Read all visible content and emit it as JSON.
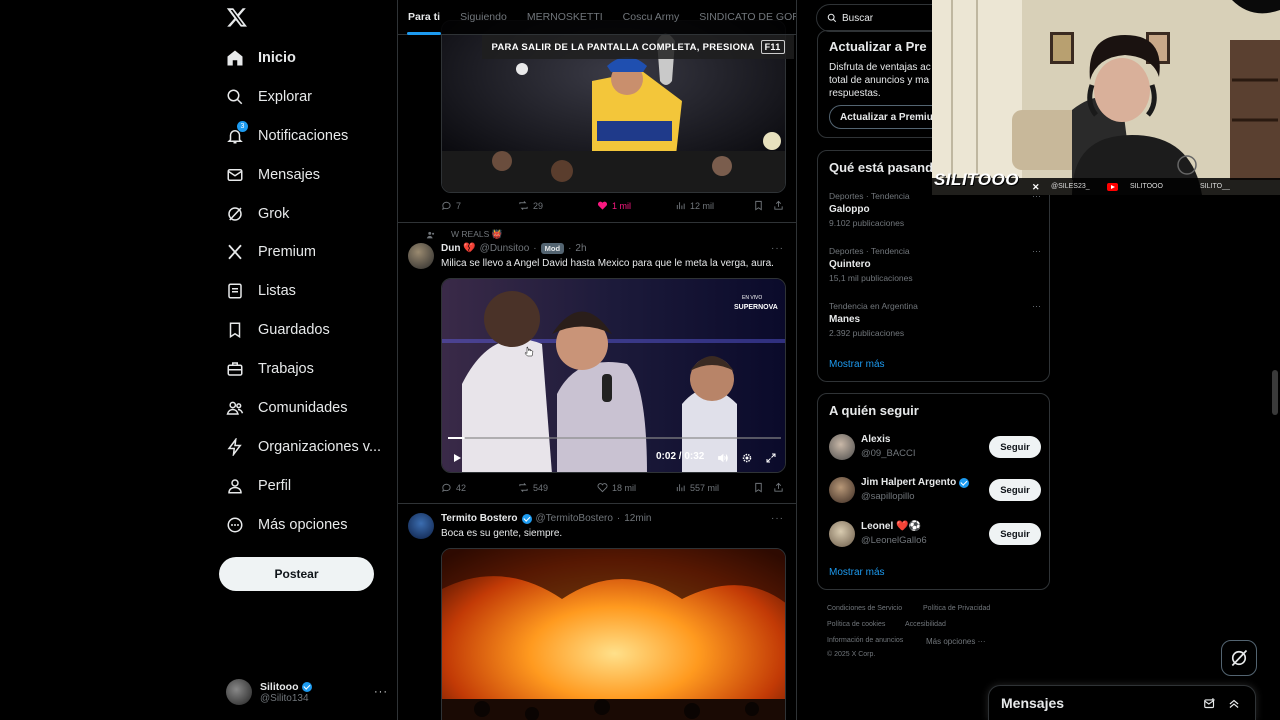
{
  "nav": {
    "items": [
      {
        "label": "Inicio",
        "icon": "home-icon"
      },
      {
        "label": "Explorar",
        "icon": "search-icon"
      },
      {
        "label": "Notificaciones",
        "icon": "bell-icon",
        "badge": "3"
      },
      {
        "label": "Mensajes",
        "icon": "mail-icon"
      },
      {
        "label": "Grok",
        "icon": "grok-icon"
      },
      {
        "label": "Premium",
        "icon": "x-logo-icon"
      },
      {
        "label": "Listas",
        "icon": "list-icon"
      },
      {
        "label": "Guardados",
        "icon": "bookmark-icon"
      },
      {
        "label": "Trabajos",
        "icon": "briefcase-icon"
      },
      {
        "label": "Comunidades",
        "icon": "people-icon"
      },
      {
        "label": "Organizaciones v...",
        "icon": "lightning-icon"
      },
      {
        "label": "Perfil",
        "icon": "person-icon"
      },
      {
        "label": "Más opciones",
        "icon": "more-circle-icon"
      }
    ],
    "post_button": "Postear",
    "account": {
      "name": "Silitooo",
      "handle": "@Silito134"
    }
  },
  "tabs": [
    "Para ti",
    "Siguiendo",
    "MERNOSKETTI",
    "Coscu Army",
    "SINDICATO DE GORD"
  ],
  "fullscreen_notice": {
    "text": "PARA SALIR DE LA PANTALLA COMPLETA, PRESIONA",
    "key": "F11"
  },
  "posts": [
    {
      "stats": {
        "replies": "7",
        "reposts": "29",
        "likes": "1 mil",
        "views": "12 mil"
      }
    },
    {
      "social_context": "W REALS 👹",
      "name": "Dun 💔",
      "handle": "@Dunsitoo",
      "badge": "Mod",
      "time": "2h",
      "text": "Milica se llevo a Angel David hasta Mexico para que le meta la verga, aura.",
      "video": {
        "time": "0:02 / 0:32",
        "progress": 0.05,
        "overlay": "EN VIVO SUPERNOVA"
      },
      "stats": {
        "replies": "42",
        "reposts": "549",
        "likes": "18 mil",
        "views": "557 mil"
      }
    },
    {
      "name": "Termito Bostero",
      "handle": "@TermitoBostero",
      "time": "12min",
      "text": "Boca es su gente, siempre."
    }
  ],
  "right": {
    "search_placeholder": "Buscar",
    "premium": {
      "title": "Actualizar a Pre",
      "desc_lines": [
        "Disfruta de ventajas ac",
        "total de anuncios y ma",
        "respuestas."
      ],
      "button": "Actualizar a Premiu"
    },
    "trends_title": "Qué está pasand",
    "trends": [
      {
        "category": "Deportes · Tendencia",
        "name": "Galoppo",
        "count": "9.102 publicaciones"
      },
      {
        "category": "Deportes · Tendencia",
        "name": "Quintero",
        "count": "15,1 mil publicaciones"
      },
      {
        "category": "Tendencia en Argentina",
        "name": "Manes",
        "count": "2.392 publicaciones"
      }
    ],
    "show_more": "Mostrar más",
    "follow_title": "A quién seguir",
    "follow": [
      {
        "name": "Alexis",
        "handle": "@09_BACCI",
        "button": "Seguir"
      },
      {
        "name": "Jim Halpert Argento",
        "handle": "@sapillopillo",
        "button": "Seguir",
        "verified": true
      },
      {
        "name": "Leonel ❤️⚽",
        "handle": "@LeonelGallo6",
        "button": "Seguir"
      }
    ],
    "follow_more": "Mostrar más",
    "footer": [
      "Condiciones de Servicio",
      "Política de Privacidad",
      "Política de cookies",
      "Accesibilidad",
      "Información de anuncios",
      "Más opciones ···",
      "© 2025 X Corp."
    ]
  },
  "webcam": {
    "name": "SILITOOO",
    "social": [
      "@SILES23_",
      "SILITOOO",
      "SILITO__"
    ]
  },
  "messages_bar": {
    "title": "Mensajes"
  },
  "colors": {
    "accent": "#1d9bf0",
    "like": "#f91880",
    "bg": "#000000",
    "border": "#2f3336",
    "muted": "#71767b"
  }
}
